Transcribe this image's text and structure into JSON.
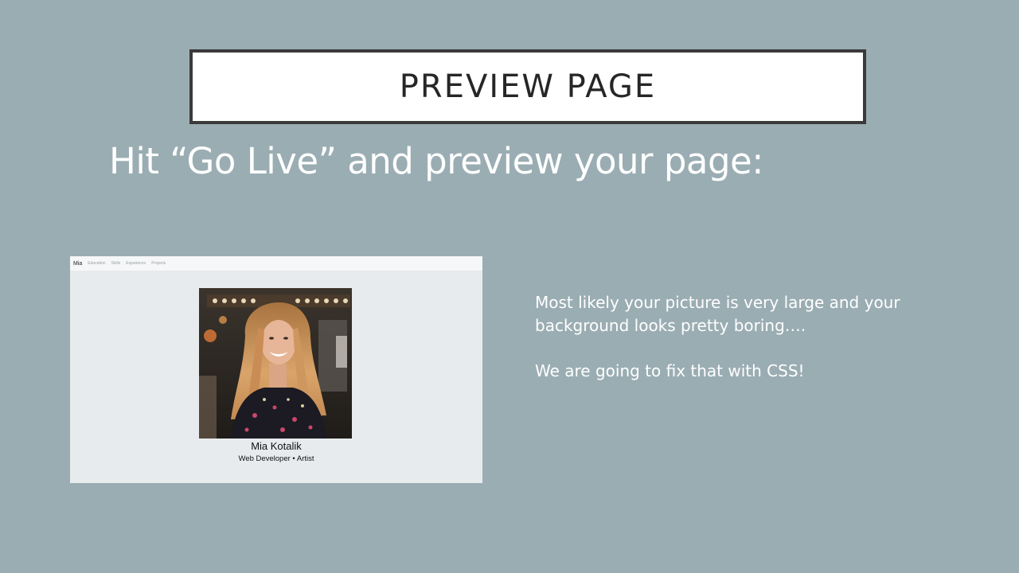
{
  "slide": {
    "title": "PREVIEW PAGE",
    "subtitle": "Hit “Go Live” and preview your page:",
    "body_line_1": "Most likely your picture is very large and your background looks pretty boring….",
    "body_line_2": "We are going to fix that with CSS!"
  },
  "preview": {
    "nav": {
      "brand": "Mia",
      "links": [
        "Education",
        "Skills",
        "Experience",
        "Projects"
      ]
    },
    "profile": {
      "name": "Mia Kotalik",
      "role": "Web Developer • Artist"
    },
    "photo_alt": "portrait photo of smiling woman"
  },
  "colors": {
    "background": "#9aadb3",
    "title_border": "#3a3a3a",
    "preview_background": "#e8ebee"
  }
}
